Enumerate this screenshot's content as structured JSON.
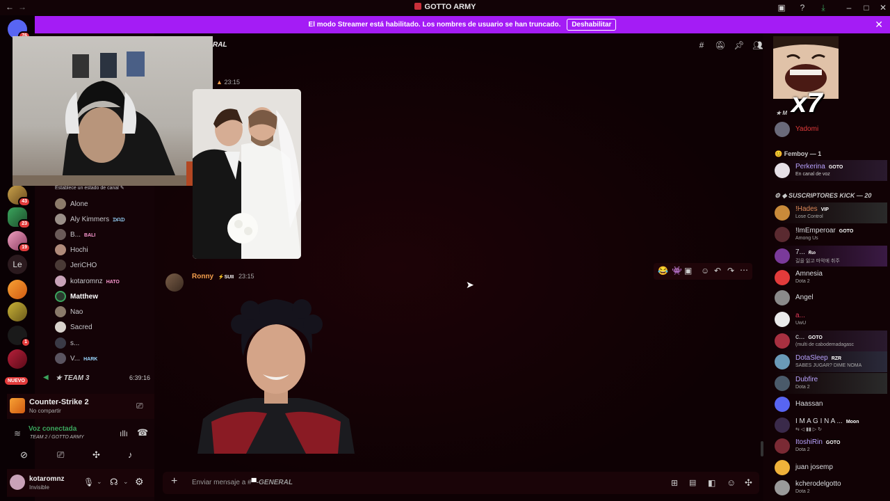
{
  "window": {
    "title": "GOTTO ARMY"
  },
  "banner": {
    "message": "El modo Streamer está habilitado. Los nombres de usuario se han truncado.",
    "button": "Deshabilitar"
  },
  "rail": {
    "badges": [
      "76",
      "43",
      "23",
      "19",
      "1"
    ],
    "text_server": "Le",
    "new_label": "NUEVO"
  },
  "channel": {
    "header_name": "RAL",
    "status_prompt": "Establece un estado de canal",
    "voice_members": [
      {
        "name": "Alone",
        "tag": ""
      },
      {
        "name": "Aly Kimmers",
        "tag": "ᗪᗩᗪ"
      },
      {
        "name": "B...",
        "tag": "BALI"
      },
      {
        "name": "Hochi",
        "tag": ""
      },
      {
        "name": "JeriCHO",
        "tag": ""
      },
      {
        "name": "kotaromnz",
        "tag": "HATO"
      },
      {
        "name": "Matthew",
        "tag": ""
      },
      {
        "name": "Nao",
        "tag": ""
      },
      {
        "name": "Sacred",
        "tag": ""
      },
      {
        "name": "s...",
        "tag": ""
      },
      {
        "name": "V...",
        "tag": "HARK"
      }
    ],
    "team_channel": {
      "name": "TEAM 3",
      "timer": "6:39:16"
    }
  },
  "activity": {
    "game": "Counter-Strike 2",
    "sub": "No compartir"
  },
  "voice": {
    "status": "Voz conectada",
    "detail": "TEAM 2 / GOTTO ARMY"
  },
  "user": {
    "name": "kotaromnz",
    "status": "Invisible"
  },
  "messages": [
    {
      "author": "",
      "time": "23:15",
      "content": "image"
    },
    {
      "author": "Ronny",
      "tag": "SUII",
      "time": "23:15",
      "content": "image"
    }
  ],
  "composer": {
    "placeholder": "Enviar mensaje a #",
    "channel": "-GENERAL"
  },
  "members": {
    "overlay_text": "x7",
    "top_group_label": "M",
    "top_member": {
      "name": "Yadomi"
    },
    "groups": [
      {
        "title": "Femboy — 1"
      },
      {
        "title": "SUSCRIPTORES KICK — 20"
      }
    ],
    "femboy": [
      {
        "name": "Perkerina",
        "tag": "GOTO",
        "status": "En canal de voz",
        "color": "#b9a3ff"
      }
    ],
    "kick": [
      {
        "name": "!Hades",
        "tag": "VIP",
        "status": "Lose Control",
        "color": "#e08a5a"
      },
      {
        "name": "!ImEmperoar",
        "tag": "GOTO",
        "status": "Among Us",
        "color": "#dbdee1"
      },
      {
        "name": "7...",
        "tag": "ᖇᔕ",
        "status": "길을 잃고 마악에 취주",
        "color": "#dbdee1"
      },
      {
        "name": "Amnesia",
        "tag": "",
        "status": "Dota 2",
        "color": "#dbdee1"
      },
      {
        "name": "Angel",
        "tag": "",
        "status": "",
        "color": "#dbdee1"
      },
      {
        "name": "a...",
        "tag": "",
        "status": "UwU",
        "color": "#e23b5a"
      },
      {
        "name": "c...",
        "tag": "GOTO",
        "status": "(multi de cabodemadagasc",
        "color": "#dbdee1"
      },
      {
        "name": "DotaSleep",
        "tag": "RZR",
        "status": "SABES JUGAR? DIME NOMA",
        "color": "#b9a3ff"
      },
      {
        "name": "Dubfire",
        "tag": "",
        "status": "Dota 2",
        "color": "#b9a3ff"
      },
      {
        "name": "Haassan",
        "tag": "",
        "status": "",
        "color": "#dbdee1"
      },
      {
        "name": "I M A G I N A ...",
        "tag": "Moon",
        "status": "",
        "color": "#dbdee1"
      },
      {
        "name": "ItoshiRin",
        "tag": "GOTO",
        "status": "Dota 2",
        "color": "#b9a3ff"
      },
      {
        "name": "juan josemp",
        "tag": "",
        "status": "",
        "color": "#dbdee1"
      },
      {
        "name": "kcherodelgotto",
        "tag": "",
        "status": "Dota 2",
        "color": "#dbdee1"
      }
    ]
  },
  "colors": {
    "banner": "#a41cf5",
    "accent_red": "#e23b3b",
    "blurple": "#5865f2"
  }
}
